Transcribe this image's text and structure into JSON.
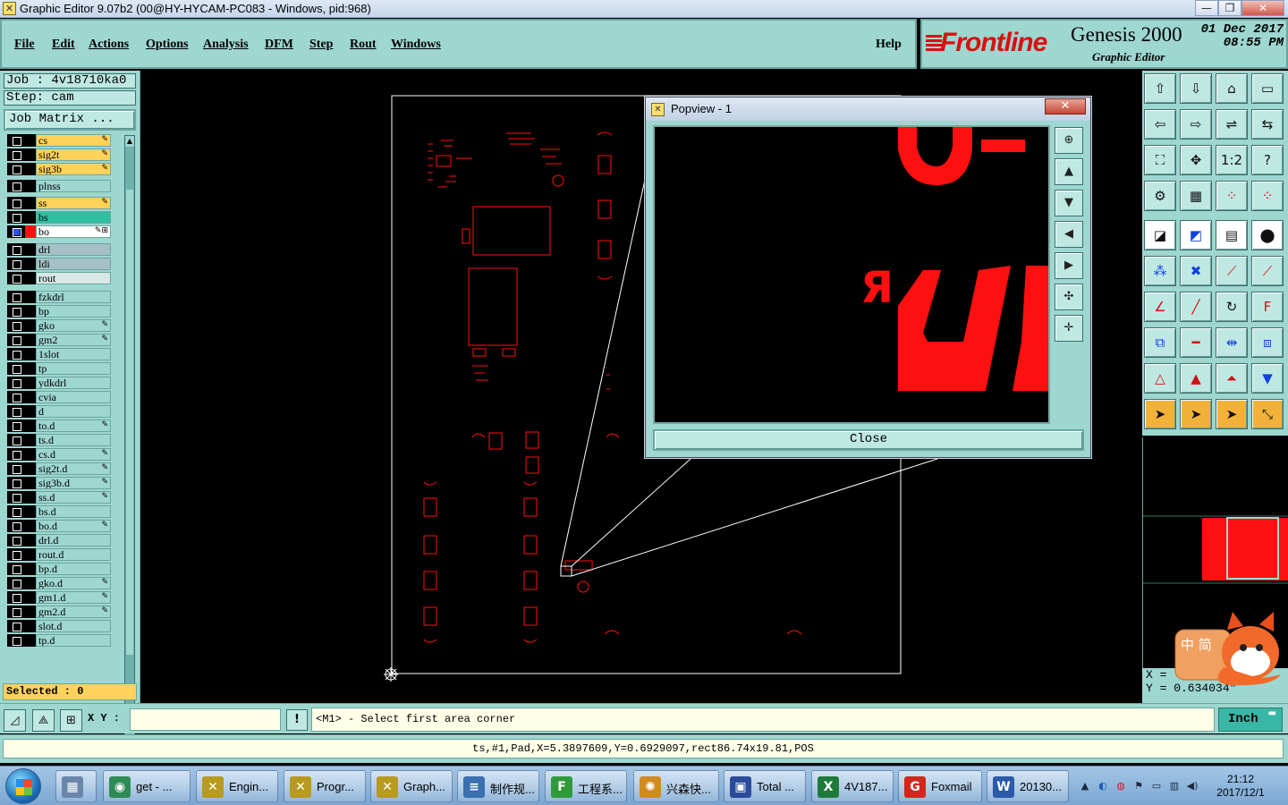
{
  "window": {
    "title": "Graphic Editor 9.07b2 (00@HY-HYCAM-PC083 - Windows, pid:968)",
    "minimize": "—",
    "maximize": "❐",
    "close": "✕"
  },
  "menu": {
    "items": [
      "File",
      "Edit",
      "Actions",
      "Options",
      "Analysis",
      "DFM",
      "Step",
      "Rout",
      "Windows"
    ],
    "help": "Help"
  },
  "branding": {
    "company": "Frontline",
    "product": "Genesis 2000",
    "subtitle": "Graphic Editor",
    "date": "01 Dec 2017",
    "time": "08:55 PM",
    "brand_color": "#d81010"
  },
  "job": {
    "job_line": "Job : 4v18710ka0",
    "step_line": "Step: cam",
    "matrix_button": "Job Matrix ...",
    "selected": "Selected : 0"
  },
  "layers": [
    {
      "name": "cs",
      "type": "sig",
      "mark": "✎"
    },
    {
      "name": "sig2t",
      "type": "sig",
      "mark": "✎"
    },
    {
      "name": "sig3b",
      "type": "sig",
      "mark": "✎"
    },
    {
      "name": "plnss",
      "type": "plain",
      "mark": ""
    },
    {
      "name": "ss",
      "type": "sig",
      "mark": "✎"
    },
    {
      "name": "bs",
      "type": "mask",
      "mark": ""
    },
    {
      "name": "bo",
      "type": "active",
      "mark": "✎⊞"
    },
    {
      "name": "drl",
      "type": "drill",
      "mark": ""
    },
    {
      "name": "ldi",
      "type": "drill",
      "mark": ""
    },
    {
      "name": "rout",
      "type": "rout",
      "mark": ""
    },
    {
      "name": "fzkdrl",
      "type": "plain",
      "mark": ""
    },
    {
      "name": "bp",
      "type": "plain",
      "mark": ""
    },
    {
      "name": "gko",
      "type": "plain",
      "mark": "✎"
    },
    {
      "name": "gm2",
      "type": "plain",
      "mark": "✎"
    },
    {
      "name": "1slot",
      "type": "plain",
      "mark": ""
    },
    {
      "name": "tp",
      "type": "plain",
      "mark": ""
    },
    {
      "name": "ydkdrl",
      "type": "plain",
      "mark": ""
    },
    {
      "name": "cvia",
      "type": "plain",
      "mark": ""
    },
    {
      "name": "d",
      "type": "plain",
      "mark": ""
    },
    {
      "name": "to.d",
      "type": "plain",
      "mark": "✎"
    },
    {
      "name": "ts.d",
      "type": "plain",
      "mark": ""
    },
    {
      "name": "cs.d",
      "type": "plain",
      "mark": "✎"
    },
    {
      "name": "sig2t.d",
      "type": "plain",
      "mark": "✎"
    },
    {
      "name": "sig3b.d",
      "type": "plain",
      "mark": "✎"
    },
    {
      "name": "ss.d",
      "type": "plain",
      "mark": "✎"
    },
    {
      "name": "bs.d",
      "type": "plain",
      "mark": ""
    },
    {
      "name": "bo.d",
      "type": "plain",
      "mark": "✎"
    },
    {
      "name": "drl.d",
      "type": "plain",
      "mark": ""
    },
    {
      "name": "rout.d",
      "type": "plain",
      "mark": ""
    },
    {
      "name": "bp.d",
      "type": "plain",
      "mark": ""
    },
    {
      "name": "gko.d",
      "type": "plain",
      "mark": "✎"
    },
    {
      "name": "gm1.d",
      "type": "plain",
      "mark": "✎"
    },
    {
      "name": "gm2.d",
      "type": "plain",
      "mark": "✎"
    },
    {
      "name": "slot.d",
      "type": "plain",
      "mark": ""
    },
    {
      "name": "tp.d",
      "type": "plain",
      "mark": ""
    }
  ],
  "popview": {
    "title": "Popview - 1",
    "close_x": "✕",
    "close_label": "Close",
    "glyph": "Я"
  },
  "coords": {
    "x_line": "X =",
    "y_line": "Y = 0.634034\""
  },
  "command": {
    "xy_label": "X Y :",
    "xy_value": "",
    "warn": "!",
    "prompt": "<M1> - Select first area corner",
    "units": "Inch"
  },
  "status": "ts,#1,Pad,X=5.3897609,Y=0.6929097,rect86.74x19.81,POS",
  "ime": "中 简",
  "taskbar": {
    "tasks": [
      {
        "label": "",
        "icon": "▦",
        "color": "#6a86a8"
      },
      {
        "label": "get - ...",
        "icon": "◉",
        "color": "#2e8b57"
      },
      {
        "label": "Engin...",
        "icon": "✕",
        "color": "#b89a20"
      },
      {
        "label": "Progr...",
        "icon": "✕",
        "color": "#b89a20"
      },
      {
        "label": "Graph...",
        "icon": "✕",
        "color": "#b89a20"
      },
      {
        "label": "制作规...",
        "icon": "≡",
        "color": "#3a6fb0"
      },
      {
        "label": "工程系...",
        "icon": "F",
        "color": "#2f9a3a"
      },
      {
        "label": "兴森快...",
        "icon": "✺",
        "color": "#d08a20"
      },
      {
        "label": "Total ...",
        "icon": "▣",
        "color": "#2a4a9a"
      },
      {
        "label": "4V187...",
        "icon": "X",
        "color": "#1f7a3a"
      },
      {
        "label": "Foxmail",
        "icon": "G",
        "color": "#d0281c"
      },
      {
        "label": "20130...",
        "icon": "W",
        "color": "#2a5aa8"
      }
    ],
    "time": "21:12",
    "date": "2017/12/1"
  }
}
